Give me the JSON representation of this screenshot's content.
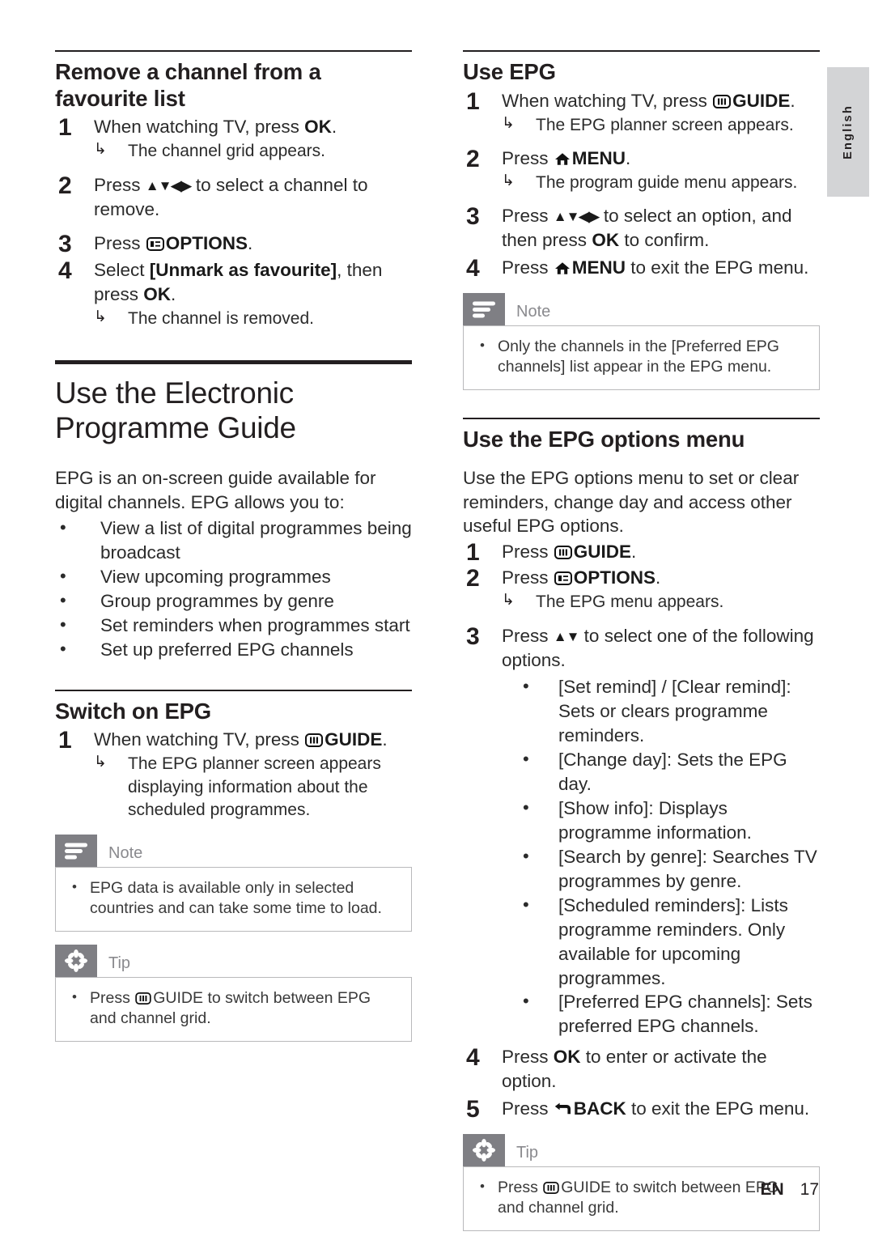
{
  "language_tab": {
    "label": "English"
  },
  "footer": {
    "lang_code": "EN",
    "page_number": "17"
  },
  "icons": {
    "guide": "guide-icon",
    "options": "options-icon",
    "menu": "home-menu-icon",
    "back": "back-arrow-icon",
    "nav_arrows": "▲▼◀▶",
    "nav_arrows_ud": "▲▼",
    "result_arrow": "↳",
    "bullet": "•"
  },
  "left_column": {
    "section_remove_favourite": {
      "heading": "Remove a channel from a favourite list",
      "steps": [
        {
          "num": "1",
          "pre": "When watching TV, press ",
          "key": "OK",
          "post": ".",
          "result": "The channel grid appears."
        },
        {
          "num": "2",
          "pre": "Press ",
          "arrows": "▲▼◀▶",
          "post": " to select a channel to remove."
        },
        {
          "num": "3",
          "pre": "Press ",
          "icon": "options-icon",
          "key": "OPTIONS",
          "post": "."
        },
        {
          "num": "4",
          "pre": "Select ",
          "bracket": "[Unmark as favourite]",
          "mid": ", then press ",
          "key": "OK",
          "post": ".",
          "result": "The channel is removed."
        }
      ]
    },
    "chapter": {
      "title": "Use the Electronic Programme Guide",
      "intro": "EPG is an on-screen guide available for digital channels. EPG allows you to:",
      "bullets": [
        "View a list of digital programmes being broadcast",
        "View upcoming programmes",
        "Group programmes by genre",
        "Set reminders when programmes start",
        "Set up preferred EPG channels"
      ]
    },
    "section_switch_on_epg": {
      "heading": "Switch on EPG",
      "steps": [
        {
          "num": "1",
          "pre": "When watching TV, press ",
          "icon": "guide-icon",
          "key": "GUIDE",
          "post": ".",
          "result": "The EPG planner screen appears displaying information about the scheduled programmes."
        }
      ],
      "note": {
        "title": "Note",
        "items": [
          "EPG data is available only in selected countries and can take some time to load."
        ]
      },
      "tip": {
        "title": "Tip",
        "item_pre": "Press ",
        "item_key": "GUIDE",
        "item_post": " to switch between EPG and channel grid."
      }
    }
  },
  "right_column": {
    "section_use_epg": {
      "heading": "Use EPG",
      "steps": [
        {
          "num": "1",
          "pre": "When watching TV, press ",
          "icon": "guide-icon",
          "key": "GUIDE",
          "post": ".",
          "result": "The EPG planner screen appears."
        },
        {
          "num": "2",
          "pre": " Press ",
          "icon": "home-menu-icon",
          "key": "MENU",
          "post": ".",
          "result": "The program guide menu appears."
        },
        {
          "num": "3",
          "pre": "Press ",
          "arrows": "▲▼◀▶",
          "mid": " to select an option, and then press ",
          "key": "OK",
          "post": " to confirm."
        },
        {
          "num": "4",
          "pre": "Press ",
          "icon": "home-menu-icon",
          "key": "MENU",
          "post": " to exit the EPG menu."
        }
      ],
      "note": {
        "title": "Note",
        "item_pre": "Only the channels in the ",
        "item_bracket": "[Preferred EPG channels]",
        "item_post": " list appear in the EPG menu."
      }
    },
    "section_epg_options": {
      "heading": "Use the EPG options menu",
      "intro": "Use the EPG options menu to set or clear reminders, change day and access other useful EPG options.",
      "steps": [
        {
          "num": "1",
          "pre": "Press ",
          "icon": "guide-icon",
          "key": "GUIDE",
          "post": "."
        },
        {
          "num": "2",
          "pre": "Press ",
          "icon": "options-icon",
          "key": "OPTIONS",
          "post": ".",
          "result": "The EPG menu appears."
        },
        {
          "num": "3",
          "pre": "Press ",
          "arrows": "▲▼",
          "post": " to select one of the following options."
        }
      ],
      "options": [
        {
          "label": "[Set remind] / [Clear remind]",
          "desc": ": Sets or clears programme reminders."
        },
        {
          "label": "[Change day]",
          "desc": ": Sets the EPG day."
        },
        {
          "label": "[Show info]",
          "desc": ": Displays programme information."
        },
        {
          "label": "[Search by genre]",
          "desc": ": Searches TV programmes by genre."
        },
        {
          "label": "[Scheduled reminders]",
          "desc": ": Lists programme reminders. Only available for upcoming programmes."
        },
        {
          "label": "[Preferred EPG channels]",
          "desc": ": Sets preferred EPG channels."
        }
      ],
      "steps_tail": [
        {
          "num": "4",
          "pre": "Press ",
          "key": "OK",
          "post": " to enter or activate the option."
        },
        {
          "num": "5",
          "pre": "Press ",
          "icon": "back-arrow-icon",
          "key": "BACK",
          "post": " to exit the EPG menu."
        }
      ],
      "tip": {
        "title": "Tip",
        "item_pre": "Press ",
        "item_key": "GUIDE",
        "item_post": " to switch between EPG and channel grid."
      }
    }
  }
}
